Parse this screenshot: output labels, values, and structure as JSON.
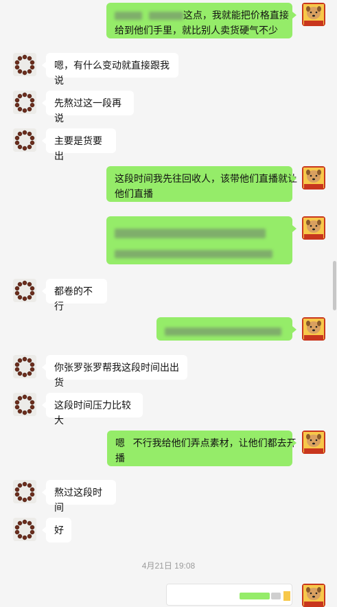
{
  "messages": [
    {
      "id": "m1",
      "side": "right",
      "text_visible": "这点，我就能把价格直接给到他们手里，就比别人卖货硬气不少",
      "line1": "这点，我就能把价格直接",
      "line2": "给到他们手里，就比别人卖货硬气不少"
    },
    {
      "id": "m2",
      "side": "left",
      "text": "嗯，有什么变动就直接跟我说"
    },
    {
      "id": "m3",
      "side": "left",
      "text": "先熬过这一段再说"
    },
    {
      "id": "m4",
      "side": "left",
      "text": "主要是货要出"
    },
    {
      "id": "m5",
      "side": "right",
      "line1": "这段时间我先往回收人，该带他们直播就让",
      "line2": "他们直播"
    },
    {
      "id": "m6",
      "side": "right",
      "blurred": true
    },
    {
      "id": "m7",
      "side": "left",
      "text": "都卷的不行"
    },
    {
      "id": "m8",
      "side": "right",
      "blurred": true
    },
    {
      "id": "m9",
      "side": "left",
      "text": "你张罗张罗帮我这段时间出出货"
    },
    {
      "id": "m10",
      "side": "left",
      "text": "这段时间压力比较大"
    },
    {
      "id": "m11",
      "side": "right",
      "line1": "嗯   不行我给他们弄点素材，让他们都去开",
      "line2": "播"
    },
    {
      "id": "m12",
      "side": "left",
      "text": "熬过这段时间"
    },
    {
      "id": "m13",
      "side": "left",
      "text": "好"
    }
  ],
  "timestamp": "4月21日 19:08",
  "avatar_left": {
    "icon": "bead-bracelet-icon"
  },
  "avatar_right": {
    "icon": "dog-avatar-icon"
  },
  "colors": {
    "green_bubble": "#95ec69",
    "white_bubble": "#ffffff",
    "background": "#f5f5f5"
  }
}
